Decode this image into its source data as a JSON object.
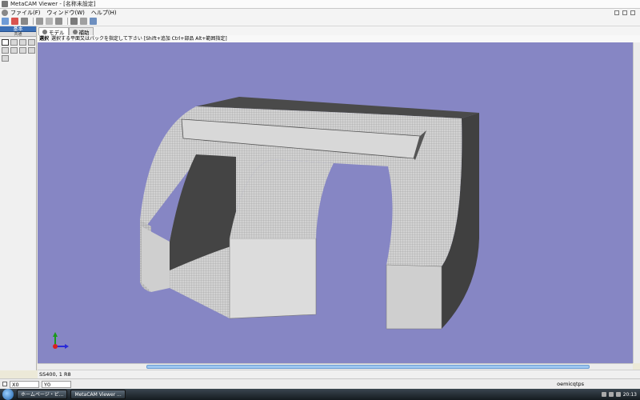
{
  "window": {
    "title": "MetaCAM Viewer - [名称未設定]"
  },
  "menu": {
    "items": [
      "ファイル(F)",
      "ウィンドウ(W)",
      "ヘルプ(H)"
    ]
  },
  "left_panel": {
    "tab_primary": "基本",
    "tab_secondary": "共通"
  },
  "tabs": [
    {
      "label": "モデル",
      "active": true
    },
    {
      "label": "補助",
      "active": false
    }
  ],
  "hint": {
    "mode": "選択",
    "text": "選択する平面又はパックを指定して下さい [Shift+追加 Ctrl+部品 Alt+範囲指定]"
  },
  "status": {
    "text": "SS400, 1 R8"
  },
  "coords": {
    "x_label": "X0",
    "y_label": "Y0",
    "right_text": "oemicqtps"
  },
  "taskbar": {
    "buttons": [
      "ホームページ・ビ...",
      "MetaCAM Viewer ..."
    ],
    "time": "20:13"
  },
  "colors": {
    "viewport": "#8686c4",
    "accent": "#3b6fb6"
  }
}
